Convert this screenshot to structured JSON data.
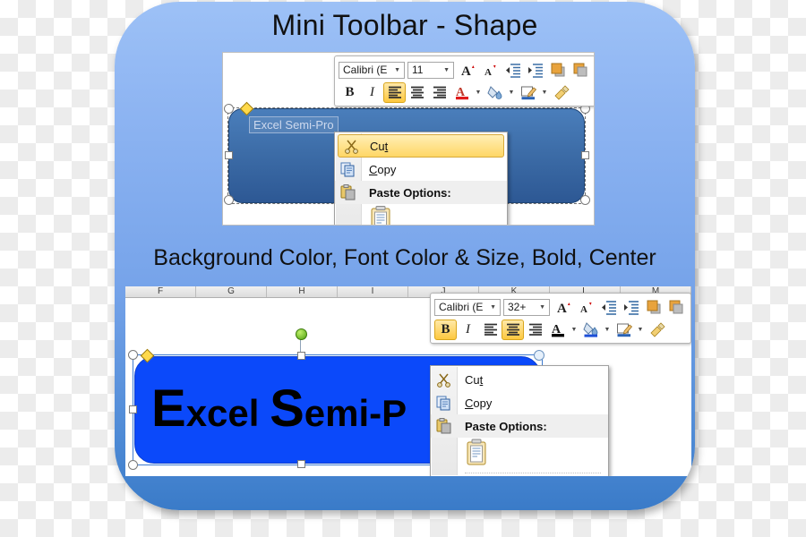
{
  "card": {
    "title": "Mini Toolbar - Shape",
    "subtitle": "Background Color, Font Color & Size, Bold, Center"
  },
  "top_screenshot": {
    "shape": {
      "text": "Excel Semi-Pro",
      "fill_color": "#3d6da8",
      "outline_color": "#1f4576",
      "text_color": "#cdd9ee"
    },
    "mini_toolbar": {
      "font_name": "Calibri (E",
      "font_size": "11",
      "buttons": [
        {
          "name": "grow-font",
          "label": "A",
          "active": false
        },
        {
          "name": "shrink-font",
          "label": "A",
          "active": false
        },
        {
          "name": "decrease-indent",
          "label": "indent",
          "active": false
        },
        {
          "name": "increase-indent",
          "label": "indent",
          "active": false
        },
        {
          "name": "bring-forward",
          "label": "forward",
          "active": false
        },
        {
          "name": "send-backward",
          "label": "backward",
          "active": false
        },
        {
          "name": "bold",
          "label": "B",
          "active": false
        },
        {
          "name": "italic",
          "label": "I",
          "active": false
        },
        {
          "name": "align-left",
          "label": "left",
          "active": true
        },
        {
          "name": "align-center",
          "label": "center",
          "active": false
        },
        {
          "name": "align-right",
          "label": "right",
          "active": false
        },
        {
          "name": "font-color",
          "label": "A",
          "active": false,
          "color": "#e01b1b"
        },
        {
          "name": "fill-color",
          "label": "fill",
          "active": false,
          "color": "#c0392b"
        },
        {
          "name": "shape-outline",
          "label": "outline",
          "active": false,
          "color": "#2a62b5"
        },
        {
          "name": "format-painter",
          "label": "painter",
          "active": false
        }
      ]
    },
    "context_menu": {
      "cut": "Cut",
      "copy": "Copy",
      "paste_options": "Paste Options:",
      "highlighted_item": "Cut"
    }
  },
  "bottom_screenshot": {
    "column_headers": [
      "F",
      "G",
      "H",
      "I",
      "J",
      "K",
      "L",
      "M"
    ],
    "shape": {
      "text_lead": "E",
      "text_mid": "xcel ",
      "text_cap2": "S",
      "text_tail": "emi-P",
      "fill_color": "#0b49fa",
      "text_color": "#000000"
    },
    "mini_toolbar": {
      "font_name": "Calibri (E",
      "font_size": "32+",
      "buttons": [
        {
          "name": "grow-font",
          "label": "A",
          "active": false
        },
        {
          "name": "shrink-font",
          "label": "A",
          "active": false
        },
        {
          "name": "decrease-indent",
          "label": "indent",
          "active": false
        },
        {
          "name": "increase-indent",
          "label": "indent",
          "active": false
        },
        {
          "name": "bring-forward",
          "label": "forward",
          "active": false
        },
        {
          "name": "send-backward",
          "label": "backward",
          "active": false
        },
        {
          "name": "bold",
          "label": "B",
          "active": true
        },
        {
          "name": "italic",
          "label": "I",
          "active": false
        },
        {
          "name": "align-left",
          "label": "left",
          "active": false
        },
        {
          "name": "align-center",
          "label": "center",
          "active": true
        },
        {
          "name": "align-right",
          "label": "right",
          "active": false
        },
        {
          "name": "font-color",
          "label": "A",
          "active": false,
          "color": "#000000"
        },
        {
          "name": "fill-color",
          "label": "fill",
          "active": false,
          "color": "#1d4fd8"
        },
        {
          "name": "shape-outline",
          "label": "outline",
          "active": false,
          "color": "#2a62b5"
        },
        {
          "name": "format-painter",
          "label": "painter",
          "active": false
        }
      ]
    },
    "context_menu": {
      "cut": "Cut",
      "copy": "Copy",
      "paste_options": "Paste Options:",
      "highlighted_item": ""
    }
  },
  "colors": {
    "card_top": "#9dc1f6",
    "card_bottom": "#3a7bc8",
    "shape_top_fill": "#3d6da8",
    "shape_bottom_fill": "#0b49fa",
    "highlight": "#fdc840"
  }
}
